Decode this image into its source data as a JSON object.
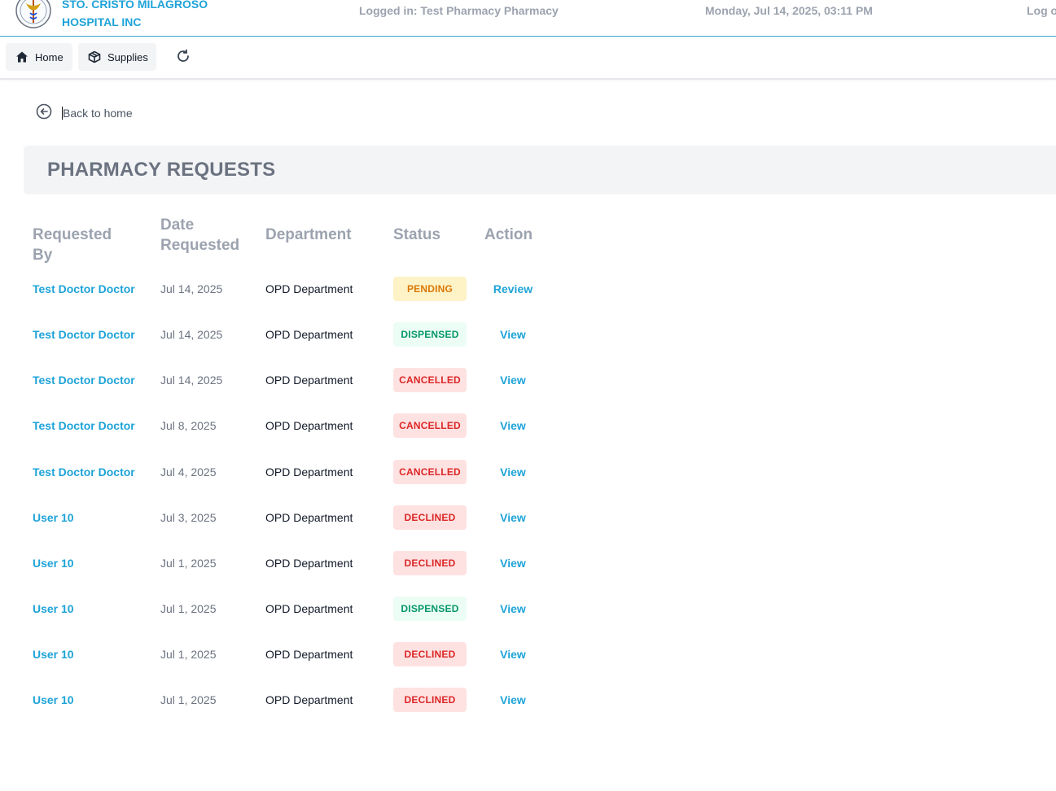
{
  "header": {
    "hospital_name_line1": "STO. CRISTO MILAGROSO",
    "hospital_name_line2": "HOSPITAL INC",
    "logged_in": "Logged in: Test Pharmacy Pharmacy",
    "datetime": "Monday, Jul 14, 2025, 03:11 PM",
    "logout": "Log o",
    "logo_icon": "hospital-seal-logo"
  },
  "nav": {
    "home_label": "Home",
    "supplies_label": "Supplies",
    "home_icon": "home-icon",
    "supplies_icon": "box-icon",
    "refresh_icon": "refresh-icon"
  },
  "back": {
    "label": "Back to home",
    "icon": "arrow-left-circle-icon"
  },
  "page": {
    "title": "PHARMACY REQUESTS"
  },
  "table": {
    "headers": {
      "requested_by": "Requested By",
      "date_line1": "Date",
      "date_line2": "Requested",
      "department": "Department",
      "status": "Status",
      "action": "Action"
    },
    "rows": [
      {
        "requested_by": "Test Doctor Doctor",
        "date": "Jul 14, 2025",
        "department": "OPD Department",
        "status": "PENDING",
        "status_kind": "pending",
        "action": "Review"
      },
      {
        "requested_by": "Test Doctor Doctor",
        "date": "Jul 14, 2025",
        "department": "OPD Department",
        "status": "DISPENSED",
        "status_kind": "dispensed",
        "action": "View"
      },
      {
        "requested_by": "Test Doctor Doctor",
        "date": "Jul 14, 2025",
        "department": "OPD Department",
        "status": "CANCELLED",
        "status_kind": "cancelled",
        "action": "View"
      },
      {
        "requested_by": "Test Doctor Doctor",
        "date": "Jul 8, 2025",
        "department": "OPD Department",
        "status": "CANCELLED",
        "status_kind": "cancelled",
        "action": "View"
      },
      {
        "requested_by": "Test Doctor Doctor",
        "date": "Jul 4, 2025",
        "department": "OPD Department",
        "status": "CANCELLED",
        "status_kind": "cancelled",
        "action": "View"
      },
      {
        "requested_by": "User 10",
        "date": "Jul 3, 2025",
        "department": "OPD Department",
        "status": "DECLINED",
        "status_kind": "declined",
        "action": "View"
      },
      {
        "requested_by": "User 10",
        "date": "Jul 1, 2025",
        "department": "OPD Department",
        "status": "DECLINED",
        "status_kind": "declined",
        "action": "View"
      },
      {
        "requested_by": "User 10",
        "date": "Jul 1, 2025",
        "department": "OPD Department",
        "status": "DISPENSED",
        "status_kind": "dispensed",
        "action": "View"
      },
      {
        "requested_by": "User 10",
        "date": "Jul 1, 2025",
        "department": "OPD Department",
        "status": "DECLINED",
        "status_kind": "declined",
        "action": "View"
      },
      {
        "requested_by": "User 10",
        "date": "Jul 1, 2025",
        "department": "OPD Department",
        "status": "DECLINED",
        "status_kind": "declined",
        "action": "View"
      }
    ]
  },
  "colors": {
    "accent": "#1ea3d8",
    "muted": "#9ca3af",
    "pending_bg": "#fef3c7",
    "dispensed_bg": "#ecfdf5",
    "cancelled_bg": "#fee2e2"
  }
}
